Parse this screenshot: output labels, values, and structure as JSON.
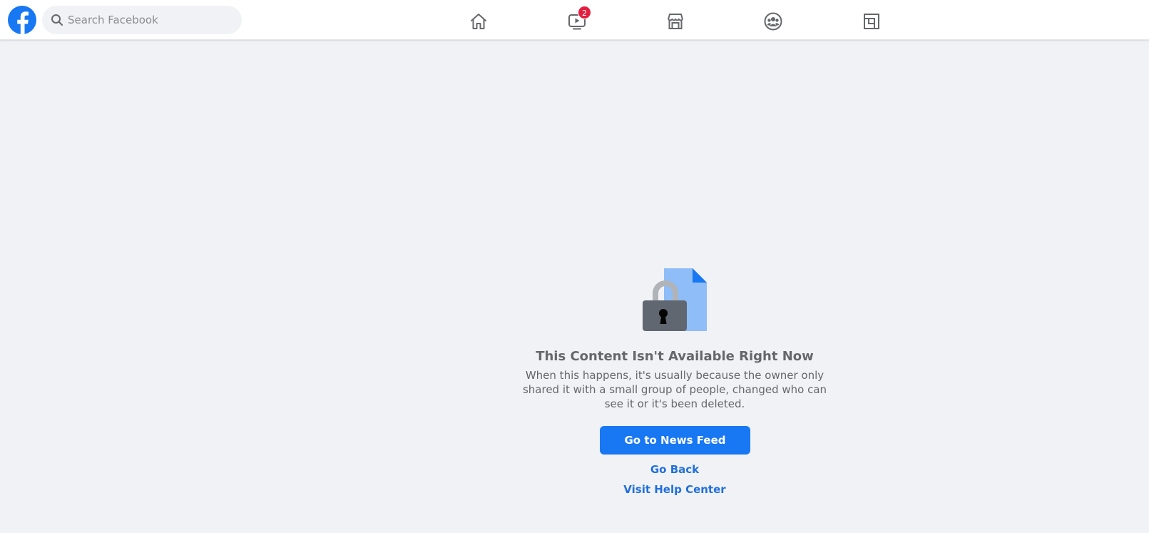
{
  "header": {
    "search": {
      "placeholder": "Search Facebook",
      "value": ""
    },
    "nav": [
      {
        "name": "home",
        "icon": "home-icon"
      },
      {
        "name": "watch",
        "icon": "video-icon",
        "badge": "2"
      },
      {
        "name": "marketplace",
        "icon": "marketplace-icon"
      },
      {
        "name": "groups",
        "icon": "groups-icon"
      },
      {
        "name": "gaming",
        "icon": "gaming-icon"
      }
    ]
  },
  "main": {
    "illustration_icon": "locked-document-icon",
    "title": "This Content Isn't Available Right Now",
    "description": "When this happens, it's usually because the owner only shared it with a small group of people, changed who can see it or it's been deleted.",
    "primary_button": "Go to News Feed",
    "links": {
      "go_back": "Go Back",
      "help_center": "Visit Help Center"
    }
  },
  "colors": {
    "brand": "#1877f2",
    "badge": "#e41e3f",
    "link": "#216fdb",
    "text_secondary": "#65676b",
    "background": "#f0f2f5"
  }
}
